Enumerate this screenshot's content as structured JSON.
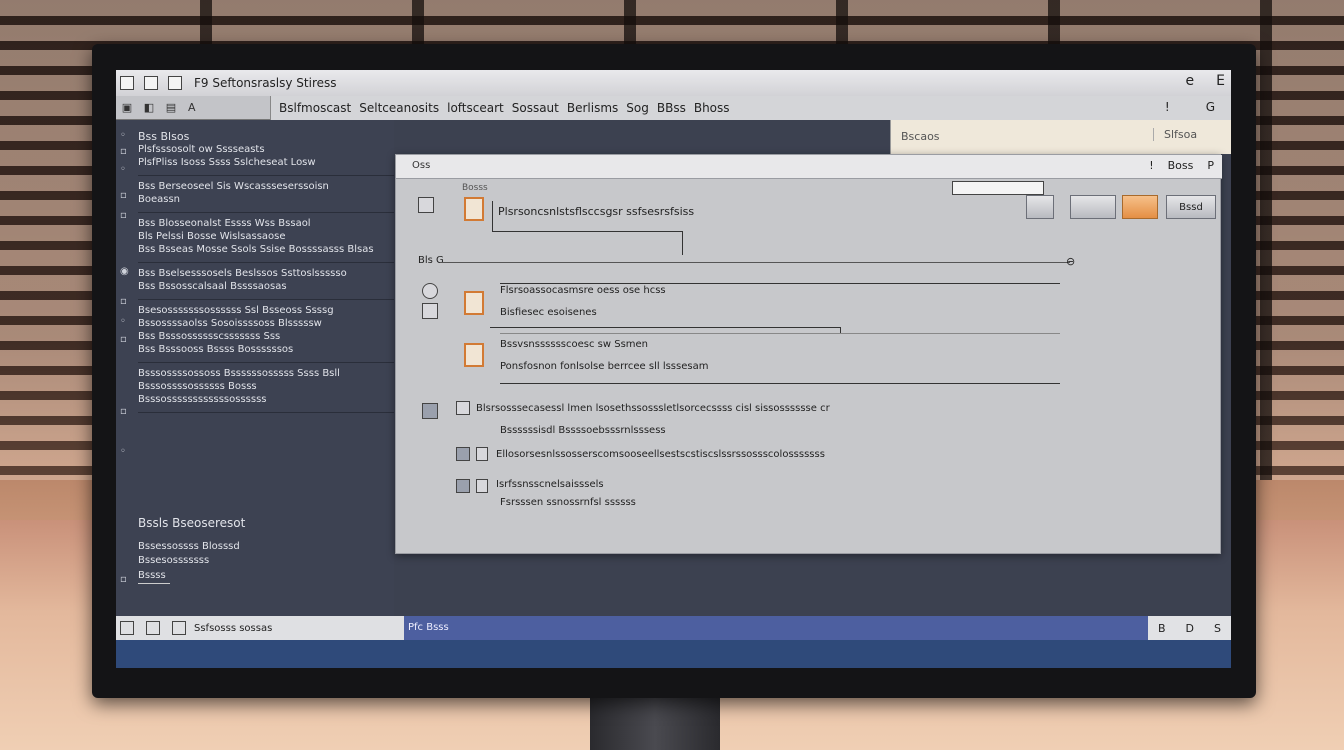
{
  "window": {
    "title": "F9 Seftonsraslsy Stiress",
    "controls": [
      "e",
      "E"
    ]
  },
  "toolbar": {
    "tool_label": "A",
    "menus": [
      "Bslfmoscast",
      "Seltceanosits",
      "loftsceart",
      "Sossaut",
      "Berlisms",
      "Sog",
      "BBss",
      "Bhoss"
    ],
    "right_icons": [
      "!",
      "G"
    ]
  },
  "sidebar": {
    "groups": [
      {
        "rows": [
          "Bss Blsos",
          "Plsfsssosolt ow Sssseasts",
          "PlsfPliss Isoss Ssss Sslcheseat Losw"
        ]
      },
      {
        "rows": [
          "Bss Berseoseel Sis Wscassseserssoisn",
          "Boeassn"
        ]
      },
      {
        "rows": [
          "Bss Blosseonalst Essss Wss Bssaol",
          "Bls Pelssi Bosse Wislsassaose",
          "Bss Bsseas Mosse Ssols Ssise Bossssasss Blsas"
        ]
      },
      {
        "rows": [
          "Bss Bselsesssosels Beslssos Ssttoslssssso",
          "Bss Bssosscalsaal Bssssaosas"
        ]
      },
      {
        "rows": [
          "Bsesosssssssossssss Ssl Bsseoss Ssssg",
          "Bssossssaolss Sosoissssoss Blsssssw",
          "Bss Bsssosssssscsssssss Sss",
          "Bss Bsssooss Bssss Bossssssos"
        ]
      },
      {
        "rows": [
          "Bsssossssossoss Bssssssosssss Ssss Bsll",
          "Bsssossssossssss Bosss",
          "Bsssossssssssssssossssss"
        ]
      }
    ],
    "footer_head": "Bssls Bseoseresot",
    "footer_rows": [
      "Bssessossss Blosssd",
      "Bssesosssssss",
      "Bssss"
    ]
  },
  "right_strip": {
    "label": "Bscaos",
    "label2": "Slfsoa"
  },
  "dialog": {
    "title": "Oss",
    "small_label": "Bosss",
    "close_icons": [
      "!",
      "Boss",
      "P"
    ],
    "buttons": [
      "",
      "",
      "",
      "Bssd"
    ],
    "row1_text": "Plsrsoncsnlstsflsccsgsr ssfsesrsfsiss",
    "slider_label": "Bls G",
    "group1_lines": [
      "Flsrsoassocasmsre oess ose hcss",
      "Bisfiesec esoisenes"
    ],
    "group2_lines": [
      "Bssvsnsssssscoesc sw Ssmen",
      "Ponsfosnon fonlsolse berrcee sll lsssesam"
    ],
    "list_items": [
      {
        "head": "Blsrsosssecasessl lmen lsosethssosssletlsorcecssss cisl sissosssssse cr",
        "sub": "Bssssssisdl Bssssoebsssrnlsssess"
      },
      {
        "head": "Ellosorsesnlssosserscomsooseellsestscstiscslssrssossscolosssssss",
        "sub": ""
      },
      {
        "head": "Isrfssnsscnelsaisssels",
        "sub": "Fsrsssen ssnossrnfsl ssssss"
      }
    ]
  },
  "status": {
    "left_text": "Ssfsosss sossas",
    "mid_text": "Pfc Bsss",
    "right_icons": [
      "B",
      "D",
      "S"
    ]
  }
}
